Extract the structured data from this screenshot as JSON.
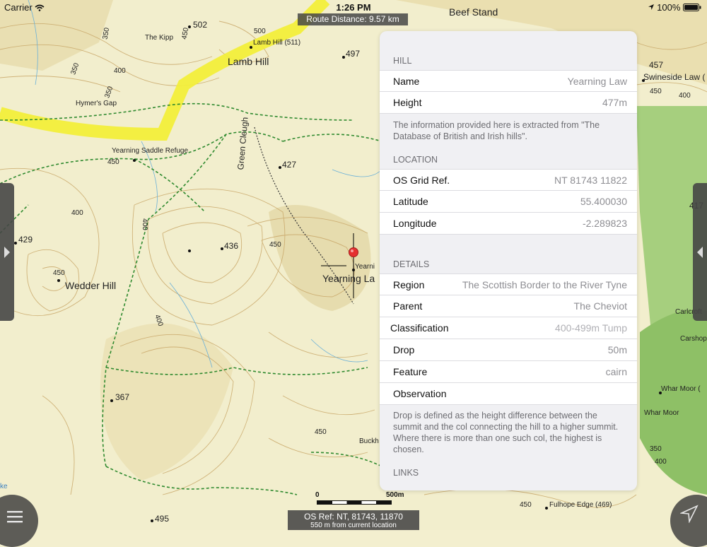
{
  "status_bar": {
    "carrier": "Carrier",
    "time": "1:26 PM",
    "battery": "100%"
  },
  "route_distance": "Route Distance: 9.57 km",
  "map_labels": {
    "beef_stand": "Beef Stand",
    "the_kipp": "The Kipp",
    "h502": "502",
    "lamb_hill_511": "Lamb Hill (511)",
    "h497": "497",
    "lamb_hill": "Lamb Hill",
    "hymers_gap": "Hymer's Gap",
    "refuge": "Yearning Saddle Refuge",
    "green_cleugh": "Green Cleugh",
    "h427": "427",
    "h429": "429",
    "h436": "436",
    "wedder_hill": "Wedder Hill",
    "yearning_small": "Yearni",
    "yearning_law": "Yearning La",
    "h367": "367",
    "h495": "495",
    "buckh": "Buckh",
    "h457": "457",
    "swineside": "Swineside Law (",
    "h417": "417",
    "carlcroft": "Carlcroft",
    "carshop": "Carshop",
    "whar_moor_a": "Whar Moor (",
    "whar_moor_b": "Whar Moor",
    "fulhope": "Fulhope Edge (469)",
    "c500": "500",
    "c450a": "450",
    "c400": "400",
    "c350": "350",
    "c450b": "450",
    "c450c": "450",
    "c400b": "400",
    "c400c": "400",
    "c450d": "450",
    "c450e": "450",
    "c400d": "400",
    "c450f": "450",
    "c450g": "450",
    "c400e": "400",
    "c400f": "400",
    "c350b": "350",
    "c350c": "350",
    "c350d": "350",
    "ke": "ke"
  },
  "scale": {
    "start": "0",
    "end": "500m"
  },
  "os_ref": {
    "line1": "OS Ref: NT, 81743, 11870",
    "line2": "550 m from current location"
  },
  "panel": {
    "hill_header": "HILL",
    "name_label": "Name",
    "name_value": "Yearning Law",
    "height_label": "Height",
    "height_value": "477m",
    "source_note": "The information provided here is extracted from \"The Database of British and Irish hills\".",
    "location_header": "LOCATION",
    "grid_label": "OS Grid Ref.",
    "grid_value": "NT 81743 11822",
    "lat_label": "Latitude",
    "lat_value": "55.400030",
    "lon_label": "Longitude",
    "lon_value": "-2.289823",
    "details_header": "DETAILS",
    "region_label": "Region",
    "region_value": "The Scottish Border to the River Tyne",
    "parent_label": "Parent",
    "parent_value": "The Cheviot",
    "class_label": "Classification",
    "class_value": "400-499m Tump",
    "drop_label": "Drop",
    "drop_value": "50m",
    "feature_label": "Feature",
    "feature_value": "cairn",
    "observation_label": "Observation",
    "drop_note": "Drop is defined as the height difference between the summit and the col connecting the hill to a higher summit. Where there is more than one such col, the highest is chosen.",
    "links_header": "LINKS"
  },
  "icons": {
    "wifi": "wifi-icon",
    "location_arrow": "location-arrow-icon",
    "battery": "battery-icon",
    "menu": "hamburger-menu-icon",
    "navigate": "navigate-arrow-icon",
    "pin": "map-pin-icon"
  },
  "colors": {
    "route": "#f2ee3a",
    "path": "#2f8a2f",
    "woodland": "#8fc36a",
    "contour": "#c9a86a",
    "pin": "#e53030"
  }
}
